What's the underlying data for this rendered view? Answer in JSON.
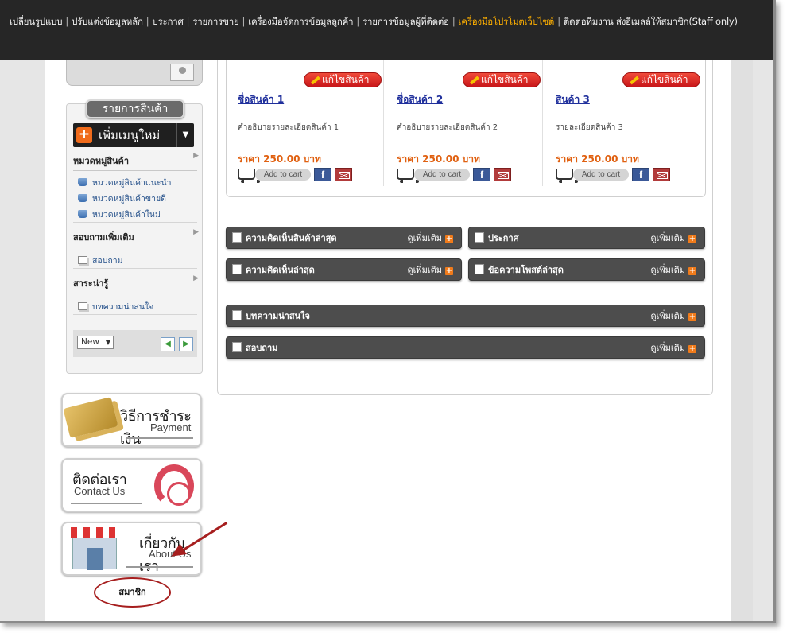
{
  "topbar": {
    "items": [
      {
        "label": "เปลี่ยนรูปแบบ",
        "active": false
      },
      {
        "label": "ปรับแต่งข้อมูลหลัก",
        "active": false
      },
      {
        "label": "ประกาศ",
        "active": false
      },
      {
        "label": "รายการขาย",
        "active": false
      },
      {
        "label": "เครื่องมือจัดการข้อมูลลูกค้า",
        "active": false
      },
      {
        "label": "รายการข้อมูลผู้ที่ติดต่อ",
        "active": false
      },
      {
        "label": "เครื่องมือโปรโมตเว็บไซต์",
        "active": true
      },
      {
        "label": "ติดต่อทีมงาน ส่งอีเมลล์ให้สมาชิก(Staff only)",
        "active": false
      }
    ],
    "separator": "|",
    "active_color": "#ffb000"
  },
  "sidebar": {
    "panel_title": "รายการสินค้า",
    "add_menu_label": "เพิ่มเมนูใหม่",
    "add_menu_plus": "+",
    "add_menu_caret": "▼",
    "sections": [
      {
        "title": "หมวดหมู่สินค้า",
        "links": [
          "หมวดหมู่สินค้าแนะนำ",
          "หมวดหมู่สินค้าขายดี",
          "หมวดหมู่สินค้าใหม่"
        ]
      },
      {
        "title": "สอบถามเพิ่มเติม",
        "links": [
          "สอบถาม"
        ]
      },
      {
        "title": "สาระน่ารู้",
        "links": [
          "บทความน่าสนใจ"
        ]
      }
    ],
    "section_arrow": "▶",
    "sort_select": "New",
    "sort_dd": "▼",
    "prev_arrow": "◀",
    "next_arrow": "▶"
  },
  "banners": {
    "payment": {
      "th": "วิธีการชำระเงิน",
      "en": "Payment"
    },
    "contact": {
      "th": "ติดต่อเรา",
      "en": "Contact Us"
    },
    "about": {
      "th": "เกี่ยวกับเรา",
      "en": "About Us"
    }
  },
  "member_label": "สมาชิก",
  "annotation_color": "#a61e1e",
  "products": [
    {
      "edit_label": "แก้ไขสินค้า",
      "name": "ชื่อสินค้า 1",
      "desc": "คำอธิบายรายละเอียดสินค้า 1",
      "price": "ราคา 250.00 บาท",
      "cart_label": "Add to cart",
      "fb": "f"
    },
    {
      "edit_label": "แก้ไขสินค้า",
      "name": "ชื่อสินค้า 2",
      "desc": "คำอธิบายรายละเอียดสินค้า 2",
      "price": "ราคา 250.00 บาท",
      "cart_label": "Add to cart",
      "fb": "f"
    },
    {
      "edit_label": "แก้ไขสินค้า",
      "name": "สินค้า 3",
      "desc": "รายละเอียดสินค้า 3",
      "price": "ราคา 250.00 บาท",
      "cart_label": "Add to cart",
      "fb": "f"
    }
  ],
  "widgets": [
    {
      "label": "ความคิดเห็นสินค้าล่าสุด",
      "more": "ดูเพิ่มเติม",
      "plus": "+"
    },
    {
      "label": "ประกาศ",
      "more": "ดูเพิ่มเติม",
      "plus": "+"
    },
    {
      "label": "ความคิดเห็นล่าสุด",
      "more": "ดูเพิ่มเติม",
      "plus": "+"
    },
    {
      "label": "ข้อความโพสต์ล่าสุด",
      "more": "ดูเพิ่มเติม",
      "plus": "+"
    },
    {
      "label": "บทความน่าสนใจ",
      "more": "ดูเพิ่มเติม",
      "plus": "+"
    },
    {
      "label": "สอบถาม",
      "more": "ดูเพิ่มเติม",
      "plus": "+"
    }
  ],
  "colors": {
    "price": "#e06010",
    "edit_button": "#d9231f",
    "product_link": "#1f2f9c",
    "topbar": "#262626"
  }
}
